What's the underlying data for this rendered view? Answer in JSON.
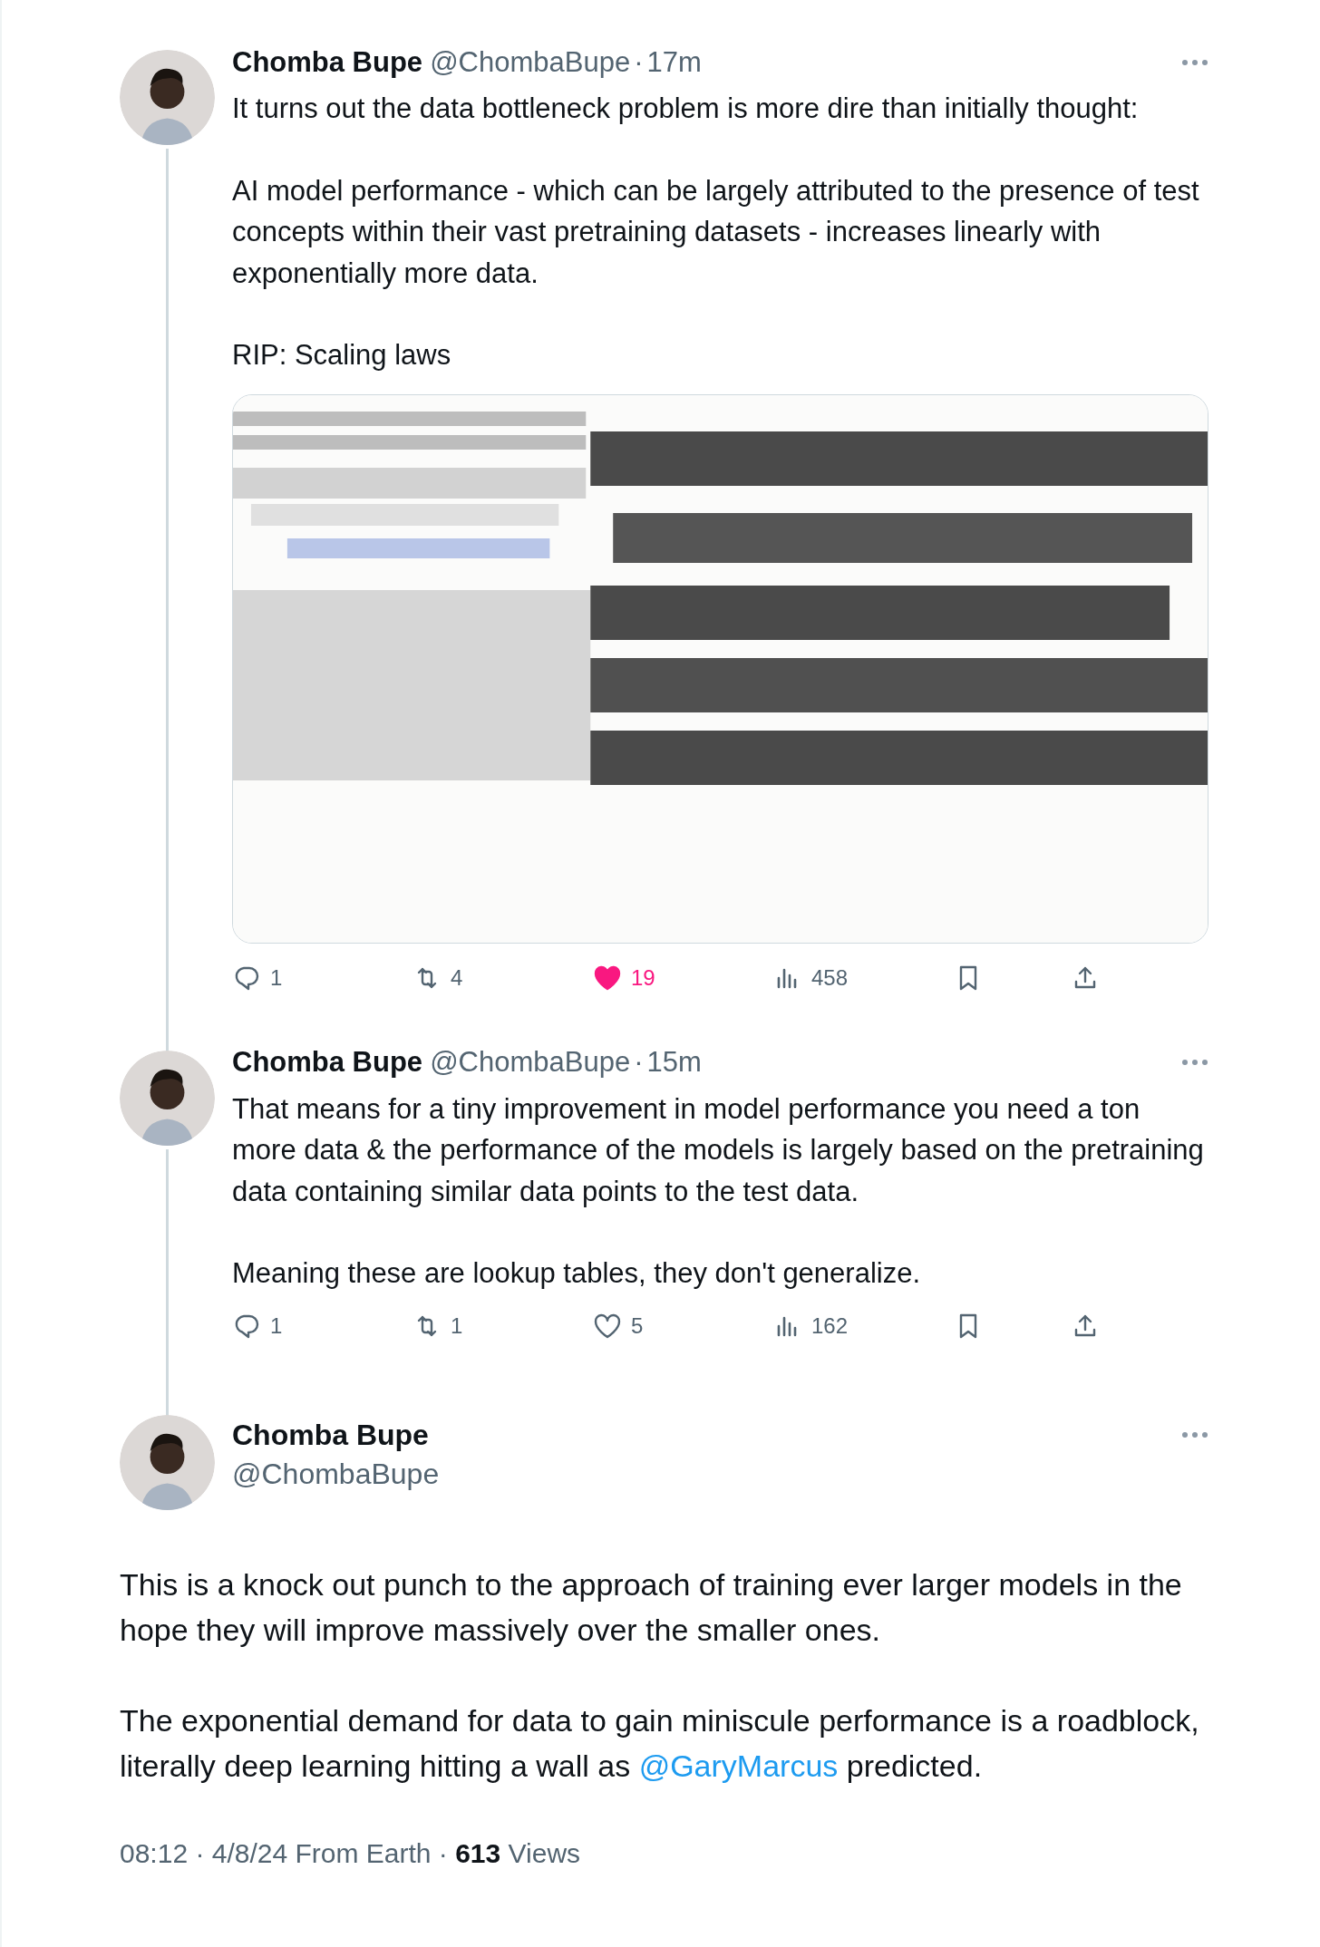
{
  "thread": [
    {
      "name": "Chomba Bupe",
      "handle": "@ChombaBupe",
      "dot": "·",
      "time": "17m",
      "body": [
        "It turns out the data bottleneck problem is more dire than initially thought:",
        "AI model performance - which can be largely attributed to the presence of test concepts within their vast pretraining datasets - increases linearly with exponentially more data.",
        "RIP: Scaling laws"
      ],
      "actions": [
        {
          "kind": "reply",
          "count": "1"
        },
        {
          "kind": "repost",
          "count": "4"
        },
        {
          "kind": "like",
          "count": "19",
          "liked": true
        },
        {
          "kind": "views",
          "count": "458"
        },
        {
          "kind": "bookmark"
        },
        {
          "kind": "share"
        }
      ]
    },
    {
      "name": "Chomba Bupe",
      "handle": "@ChombaBupe",
      "dot": "·",
      "time": "15m",
      "body": [
        "That means for a tiny improvement in model performance you need a ton more data & the performance of the models is largely based on the pretraining data containing similar data points to the test data.",
        "Meaning these are lookup tables, they don't generalize."
      ],
      "actions": [
        {
          "kind": "reply",
          "count": "1"
        },
        {
          "kind": "repost",
          "count": "1"
        },
        {
          "kind": "like",
          "count": "5",
          "liked": false
        },
        {
          "kind": "views",
          "count": "162"
        },
        {
          "kind": "bookmark"
        },
        {
          "kind": "share"
        }
      ]
    }
  ],
  "main_tweet": {
    "name": "Chomba Bupe",
    "handle": "@ChombaBupe",
    "body": [
      [
        {
          "text": "This is a knock out punch to the approach of training ever larger models in the hope they will improve massively over the smaller ones."
        }
      ],
      [
        {
          "text": "The exponential demand for data to gain miniscule performance is a roadblock, literally deep learning hitting a wall as "
        },
        {
          "text": "@GaryMarcus",
          "kind": "mention"
        },
        {
          "text": " predicted."
        }
      ]
    ],
    "meta": "08:12 · 4/8/24 From Earth · **613** Views"
  }
}
